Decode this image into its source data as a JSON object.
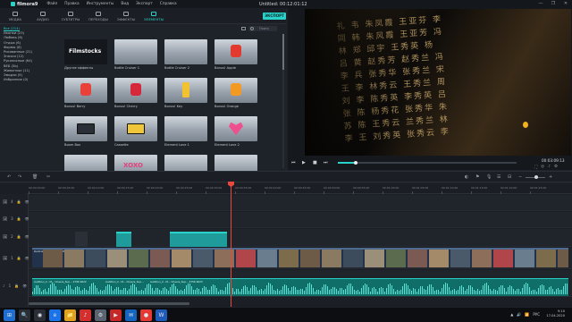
{
  "app": {
    "logo": "filmora9",
    "title": "Untitled: 00:12:01:12",
    "window_controls": [
      "—",
      "❐",
      "✕"
    ]
  },
  "menu": [
    "Файл",
    "Правка",
    "Инструменты",
    "Вид",
    "Экспорт",
    "Справка"
  ],
  "tabs": [
    {
      "label": "МЕДИА",
      "active": false
    },
    {
      "label": "АУДИО",
      "active": false
    },
    {
      "label": "СУБТИТРЫ",
      "active": false
    },
    {
      "label": "ПЕРЕХОДЫ",
      "active": false
    },
    {
      "label": "ЭФФЕКТЫ",
      "active": false
    },
    {
      "label": "ЭЛЕМЕНТЫ",
      "active": true
    }
  ],
  "export_label": "ЭКСПОРТ",
  "categories": [
    "Все (214)",
    "Иконки (23)",
    "Любовь (6)",
    "Отдых (6)",
    "Формы (6)",
    "Рисованные (21)",
    "Значки (12)",
    "Рукописные (64)",
    "ВЕБ (5b)",
    "Животные (11)",
    "Эмодзи (9)",
    "Избранное (0)"
  ],
  "search_placeholder": "Поиск",
  "elements": [
    {
      "label": "Другие эффекты",
      "thumb": "filmstocks",
      "text": "Filmstocks"
    },
    {
      "label": "Bottle Cruiser 1",
      "thumb": "scene"
    },
    {
      "label": "Bottle Cruiser 2",
      "thumb": "scene"
    },
    {
      "label": "Bonus! Apple",
      "thumb": "pixel-apple"
    },
    {
      "label": "Bonus! Berry",
      "thumb": "pixel-berry"
    },
    {
      "label": "Bonus! Cherry",
      "thumb": "pixel-cherry"
    },
    {
      "label": "Bonus! Key",
      "thumb": "pixel-key"
    },
    {
      "label": "Bonus! Orange",
      "thumb": "pixel-orange"
    },
    {
      "label": "Boom Box",
      "thumb": "boombox"
    },
    {
      "label": "Cassette",
      "thumb": "cassette"
    },
    {
      "label": "Element Love 1",
      "thumb": "scene"
    },
    {
      "label": "Element Love 2",
      "thumb": "heart"
    },
    {
      "label": "",
      "thumb": "love"
    },
    {
      "label": "",
      "thumb": "xoxo",
      "text": "XOXO"
    },
    {
      "label": "",
      "thumb": "scene"
    },
    {
      "label": "",
      "thumb": "scene"
    }
  ],
  "preview": {
    "timecode": "00:03:09:13",
    "progress": 0.1,
    "glyph_lines": [
      "礼 韦 朱凤霞 王亚芬 李",
      "同 韩 朱风霞 王亚芳 冯",
      "林 郑 邱宇 王秀英 杨",
      "吕 黄 赵秀芳 赵秀兰 冯",
      "李 兵 张秀华 张秀兰 宋",
      "王 李 林秀云 王秀兰 周",
      "刘 李 陈秀英 李秀英 吕",
      "张 陈 杨秀花 张秀华 朱",
      "苏 陈 王秀云 兰秀兰 林",
      "李 王 刘秀英 张秀云 李"
    ]
  },
  "ruler_times": [
    "00:00:00:00",
    "00:00:05:00",
    "00:00:10:00",
    "00:00:15:00",
    "00:00:20:00",
    "00:00:25:00",
    "00:00:30:00",
    "00:00:35:00",
    "00:00:40:00",
    "00:00:45:00",
    "00:00:50:00",
    "00:00:55:00",
    "00:01:00:00",
    "00:01:05:00",
    "00:01:10:00",
    "00:01:15:00",
    "00:01:20:00",
    "00:01:25:00"
  ],
  "tracks": [
    {
      "label": "4"
    },
    {
      "label": "3"
    },
    {
      "label": "2"
    },
    {
      "label": "1"
    },
    {
      "label": "1"
    }
  ],
  "clips": {
    "video_label": "Dedication ... My Grandfather's Story",
    "audio_labels": [
      "Audition_2 - M... Cheers_Sup... 2796 9022",
      "Audition_2 - M... Cheers_Sup...",
      "Audition_2 - M... Cheers_Sup... 4756 9023"
    ]
  },
  "taskbar": {
    "apps": [
      "⊞",
      "🔍",
      "◉",
      "e",
      "📁",
      "♪",
      "⚙",
      "▶",
      "✉",
      "●",
      "W"
    ],
    "time": "9:10",
    "date": "17.04.2020",
    "lang": "РУС"
  }
}
